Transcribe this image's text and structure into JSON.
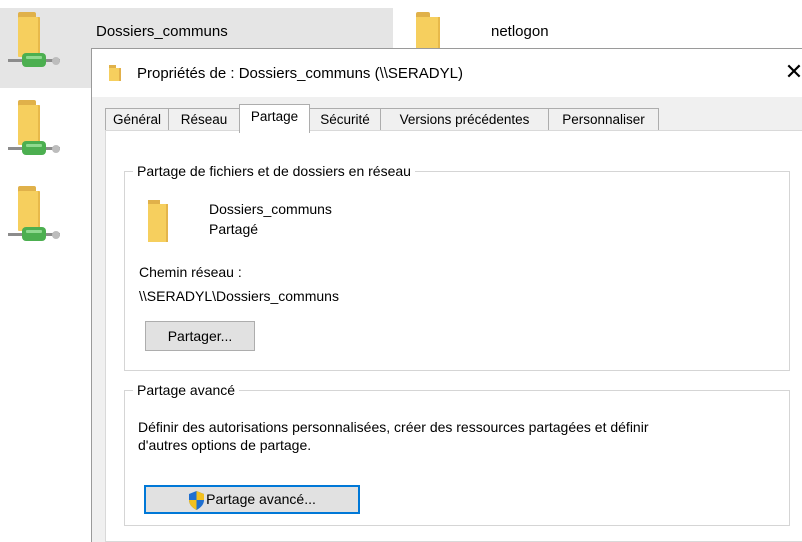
{
  "explorer": {
    "items": [
      {
        "name": "Dossiers_communs",
        "selected": true
      },
      {
        "name": "netlogon",
        "selected": false
      }
    ]
  },
  "dialog": {
    "title": "Propriétés de : Dossiers_communs (\\\\SERADYL)",
    "close_glyph": "✕",
    "tabs": [
      {
        "label": "Général",
        "active": false
      },
      {
        "label": "Réseau",
        "active": false
      },
      {
        "label": "Partage",
        "active": true
      },
      {
        "label": "Sécurité",
        "active": false
      },
      {
        "label": "Versions précédentes",
        "active": false
      },
      {
        "label": "Personnaliser",
        "active": false
      }
    ],
    "file_sharing": {
      "group_title": "Partage de fichiers et de dossiers en réseau",
      "folder_name": "Dossiers_communs",
      "status": "Partagé",
      "network_path_label": "Chemin réseau :",
      "network_path": "\\\\SERADYL\\Dossiers_communs",
      "share_button": "Partager..."
    },
    "advanced_sharing": {
      "group_title": "Partage avancé",
      "description_line1": "Définir des autorisations personnalisées, créer des ressources partagées et définir",
      "description_line2": "d'autres options de partage.",
      "button": "Partage avancé..."
    }
  },
  "colors": {
    "accent": "#0078d7",
    "folder": "#f6cf5e",
    "network_cable": "#4caf50"
  }
}
